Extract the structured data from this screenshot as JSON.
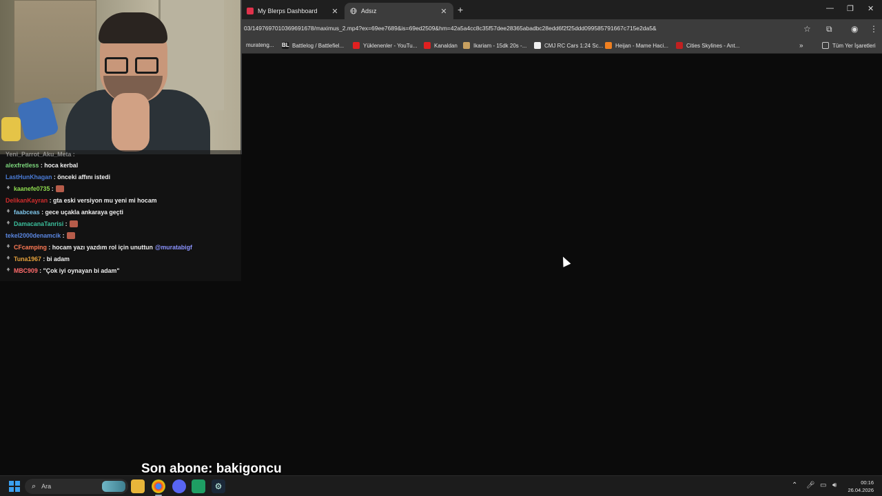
{
  "browser": {
    "tabs": [
      {
        "label": "My Blerps Dashboard",
        "active": false
      },
      {
        "label": "Adsız",
        "active": true
      }
    ],
    "url": "03/1497697010369691678/maximus_2.mp4?ex=69ee7689&is=69ed2509&hm=42a5a4cc8c35f57dee28365abadbc28edd6f2f25ddd099585791667c715e2da5&",
    "bookmarks": [
      {
        "label": "murateng...",
        "icon_color": "#555555"
      },
      {
        "label": "Battlelog / Battlefiel...",
        "icon_color": "#1b1b1b"
      },
      {
        "label": "Yüklenenler - YouTu...",
        "icon_color": "#e02020"
      },
      {
        "label": "Kanaldan",
        "icon_color": "#e02020"
      },
      {
        "label": "Ikariam - 15dk 20s -...",
        "icon_color": "#c8a060"
      },
      {
        "label": "CMJ RC Cars 1:24 Sc...",
        "icon_color": "#f0f0f0"
      },
      {
        "label": "Heijan - Mame Haci...",
        "icon_color": "#f08020"
      },
      {
        "label": "Cities Skylines - Ant...",
        "icon_color": "#c02020"
      }
    ],
    "all_bookmarks_label": "Tüm Yer İşaretleri",
    "icons": {
      "new_tab": "plus-icon",
      "minimize": "minimize-icon",
      "restore": "restore-icon",
      "close": "close-icon",
      "star": "star-icon",
      "extensions": "puzzle-icon",
      "profile": "profile-icon",
      "menu": "kebab-menu-icon"
    }
  },
  "chat": {
    "partial_top": "Yeni_Parrot_Aku_Meta :",
    "messages": [
      {
        "user": "alexfretless",
        "color": "#7bd47b",
        "text": "hoca kerbal",
        "badge": false,
        "emote": false
      },
      {
        "user": "LastHunKhagan",
        "color": "#4a7bd6",
        "text": "önceki affını istedi",
        "badge": false,
        "emote": false
      },
      {
        "user": "kaanefe0735",
        "color": "#8fdc4f",
        "text": "",
        "badge": true,
        "emote": true
      },
      {
        "user": "DelikanKayran",
        "color": "#d22d2d",
        "text": "gta eski versiyon mu yeni mi hocam",
        "badge": false,
        "emote": false
      },
      {
        "user": "faabceas",
        "color": "#7dc4e8",
        "text": "gece uçakla ankaraya geçti",
        "badge": true,
        "emote": false
      },
      {
        "user": "DamacanaTanrisi",
        "color": "#3bbf9c",
        "text": "",
        "badge": true,
        "emote": true
      },
      {
        "user": "tekel2000denamcik",
        "color": "#5a86e0",
        "text": "",
        "badge": false,
        "emote": true
      },
      {
        "user": "CFcamping",
        "color": "#ff7a55",
        "text": "hocam yazı yazdım rol için unuttun",
        "mention": "@muratabigf",
        "badge": true,
        "emote": false
      },
      {
        "user": "Tuna1967",
        "color": "#e6a23c",
        "text": "bi adam",
        "badge": true,
        "emote": false
      },
      {
        "user": "MBC909",
        "color": "#ff6b6b",
        "text": "\"Çok iyi oynayan bi adam\"",
        "badge": true,
        "emote": false
      }
    ]
  },
  "overlay": {
    "last_sub": "Son abone: bakigoncu"
  },
  "taskbar": {
    "search_placeholder": "Ara",
    "apps": [
      "file-explorer-icon",
      "chrome-icon",
      "discord-icon",
      "app-icon",
      "steam-icon"
    ],
    "time": "00:16",
    "date": "26.04.2026"
  }
}
